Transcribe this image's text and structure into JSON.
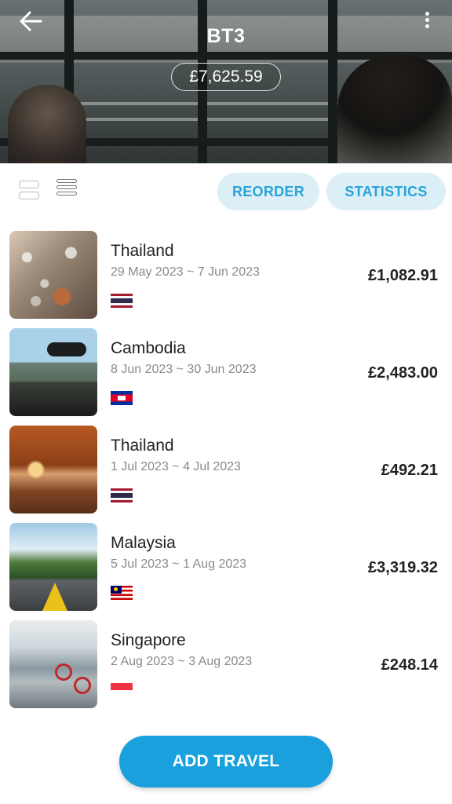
{
  "header": {
    "title": "BT3",
    "total": "£7,625.59",
    "back_icon": "arrow-left-icon",
    "menu_icon": "more-vertical-icon"
  },
  "toolbar": {
    "view_icons": [
      "card-view-icon",
      "list-view-icon"
    ],
    "reorder_label": "REORDER",
    "statistics_label": "STATISTICS"
  },
  "travels": [
    {
      "country": "Thailand",
      "dates": "29 May 2023 ~ 7 Jun 2023",
      "amount": "£1,082.91",
      "flag": "thailand-flag-icon"
    },
    {
      "country": "Cambodia",
      "dates": "8 Jun 2023 ~ 30 Jun 2023",
      "amount": "£2,483.00",
      "flag": "cambodia-flag-icon"
    },
    {
      "country": "Thailand",
      "dates": "1 Jul 2023 ~ 4 Jul 2023",
      "amount": "£492.21",
      "flag": "thailand-flag-icon"
    },
    {
      "country": "Malaysia",
      "dates": "5 Jul 2023 ~ 1 Aug 2023",
      "amount": "£3,319.32",
      "flag": "malaysia-flag-icon"
    },
    {
      "country": "Singapore",
      "dates": "2 Aug 2023 ~ 3 Aug 2023",
      "amount": "£248.14",
      "flag": "singapore-flag-icon"
    }
  ],
  "footer": {
    "add_label": "ADD TRAVEL"
  },
  "colors": {
    "accent": "#1aa0dc",
    "pill_bg": "#dceff6",
    "pill_text": "#2aa3d8"
  }
}
